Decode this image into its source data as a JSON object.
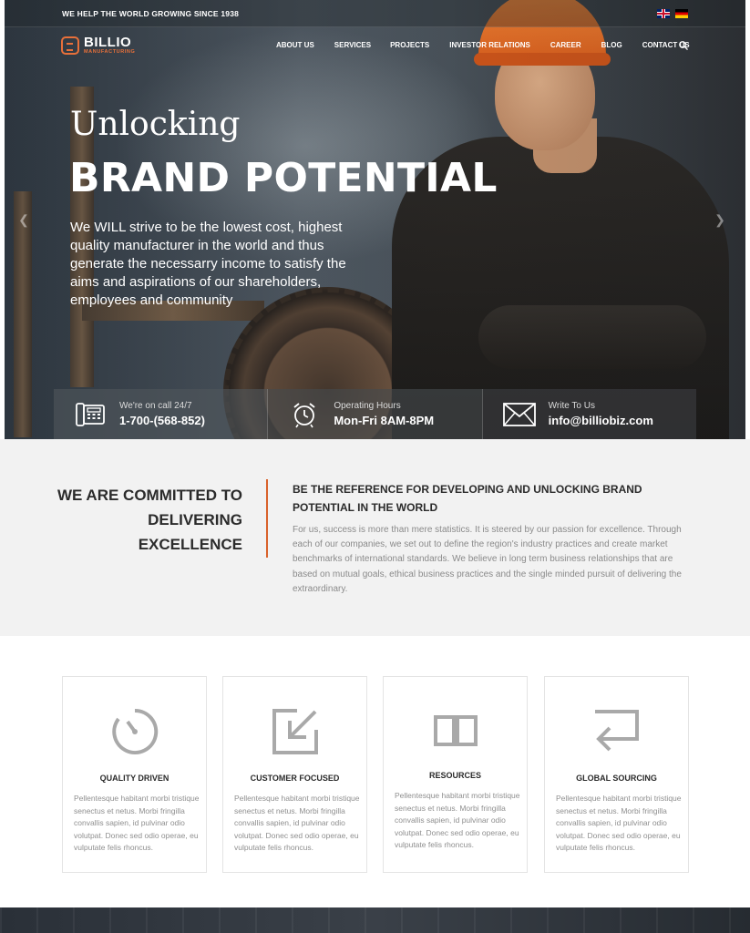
{
  "topbar": {
    "tagline": "WE HELP THE WORLD GROWING SINCE 1938",
    "languages": [
      "uk-flag",
      "de-flag"
    ]
  },
  "brand": {
    "name": "BILLIO",
    "subtitle": "MANUFACTURING",
    "accent": "#e8703a"
  },
  "nav": {
    "items": [
      "ABOUT US",
      "SERVICES",
      "PROJECTS",
      "INVESTOR RELATIONS",
      "CAREER",
      "BLOG",
      "CONTACT US"
    ],
    "search_icon": "search-icon"
  },
  "hero": {
    "kicker": "Unlocking",
    "title": "BRAND POTENTIAL",
    "text": "We WILL strive to be the lowest cost, highest quality manufacturer in the world and thus generate the necessarry income to satisfy the aims and aspirations of our shareholders, employees and community"
  },
  "info": [
    {
      "icon": "phone-icon",
      "label": "We're on call 24/7",
      "value": "1-700-(568-852)"
    },
    {
      "icon": "alarm-clock-icon",
      "label": "Operating Hours",
      "value": "Mon-Fri 8AM-8PM"
    },
    {
      "icon": "envelope-icon",
      "label": "Write To Us",
      "value": "info@billiobiz.com"
    }
  ],
  "commitment": {
    "heading_lines": [
      "WE ARE COMMITTED TO",
      "DELIVERING",
      "EXCELLENCE"
    ],
    "subheading": "BE THE REFERENCE FOR DEVELOPING AND UNLOCKING BRAND POTENTIAL IN THE  WORLD",
    "body": "For us, success is more than mere statistics. It is steered by our passion for excellence. Through each of our companies, we set out to define the region's industry practices and create market benchmarks of international standards. We believe in long term business relationships that are based on mutual goals, ethical business practices and the single minded pursuit of delivering the extraordinary.",
    "divider_color": "#d9622b"
  },
  "features": [
    {
      "icon": "gauge-icon",
      "title": "QUALITY DRIVEN",
      "text": "Pellentesque habitant morbi tristique senectus et netus. Morbi fringilla convallis sapien, id pulvinar odio volutpat. Donec sed odio operae, eu vulputate felis rhoncus."
    },
    {
      "icon": "arrow-in-box-icon",
      "title": "CUSTOMER FOCUSED",
      "text": "Pellentesque habitant morbi tristique senectus et netus. Morbi fringilla convallis sapien, id pulvinar odio volutpat. Donec sed odio operae, eu vulputate felis rhoncus."
    },
    {
      "icon": "open-book-icon",
      "title": "RESOURCES",
      "text": "Pellentesque habitant morbi tristique senectus et netus. Morbi fringilla convallis sapien, id pulvinar odio volutpat. Donec sed odio operae, eu vulputate felis rhoncus."
    },
    {
      "icon": "return-arrow-icon",
      "title": "GLOBAL SOURCING",
      "text": "Pellentesque habitant morbi tristique senectus et netus. Morbi fringilla convallis sapien, id pulvinar odio volutpat. Donec sed odio operae, eu vulputate felis rhoncus."
    }
  ]
}
